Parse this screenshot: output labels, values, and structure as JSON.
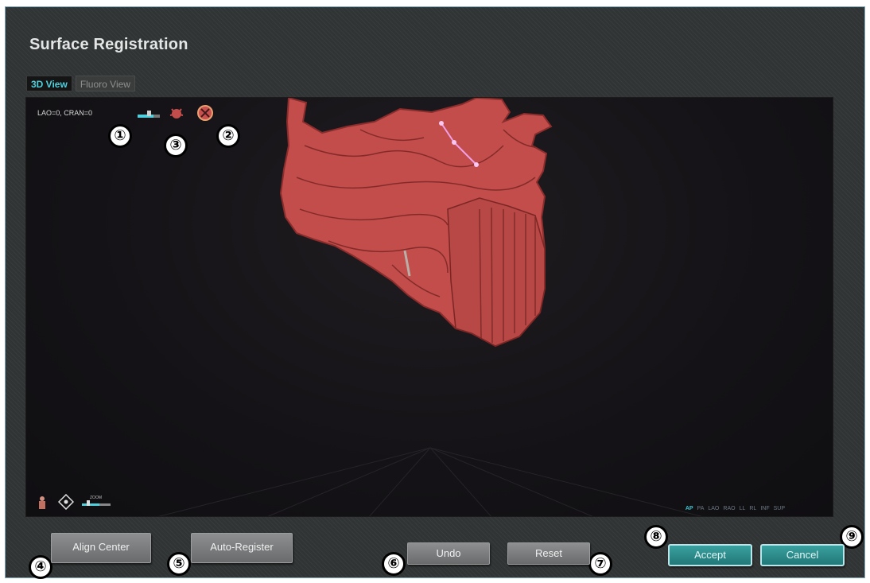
{
  "window": {
    "title": "Surface Registration"
  },
  "tabs": [
    {
      "label": "3D View",
      "active": true
    },
    {
      "label": "Fluoro View",
      "active": false
    }
  ],
  "viewport": {
    "angle_label": "LAO=0, CRAN=0",
    "zoom_label": "ZOOM",
    "view_presets": [
      {
        "label": "AP",
        "active": true
      },
      {
        "label": "PA",
        "active": false
      },
      {
        "label": "LAO",
        "active": false
      },
      {
        "label": "RAO",
        "active": false
      },
      {
        "label": "LL",
        "active": false
      },
      {
        "label": "RL",
        "active": false
      },
      {
        "label": "INF",
        "active": false
      },
      {
        "label": "SUP",
        "active": false
      }
    ],
    "icons": [
      "opacity-slider-icon",
      "anatomy-icon",
      "hide-points-icon",
      "body-orientation-icon",
      "pan-icon",
      "zoom-slider-icon"
    ]
  },
  "buttons": {
    "align_center": "Align Center",
    "auto_register": "Auto-Register",
    "undo": "Undo",
    "reset": "Reset",
    "accept": "Accept",
    "cancel": "Cancel"
  },
  "callouts": [
    "①",
    "②",
    "③",
    "④",
    "⑤",
    "⑥",
    "⑦",
    "⑧",
    "⑨"
  ],
  "colors": {
    "accent": "#4fd0dd",
    "model": "#c8504e",
    "points": "#f0a0e8",
    "panel_bg": "#303434"
  }
}
